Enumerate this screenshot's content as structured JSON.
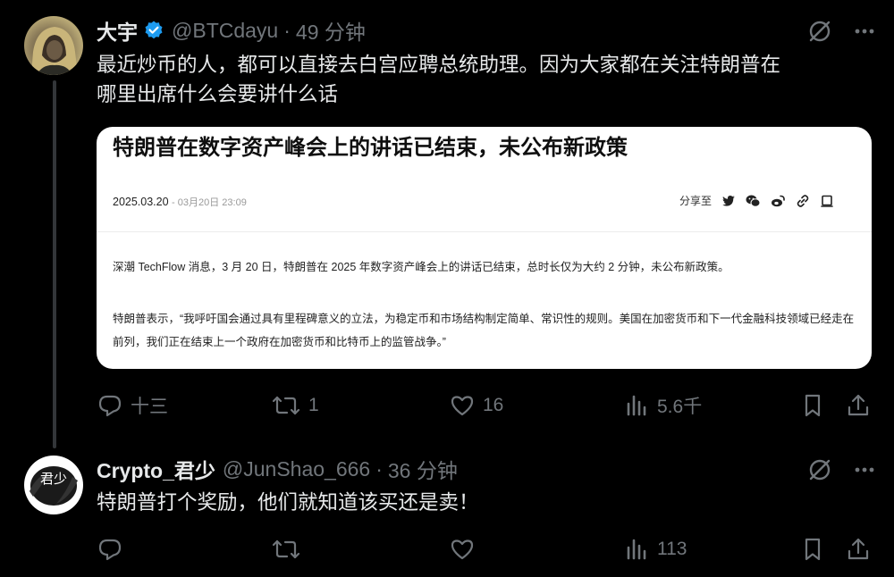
{
  "post": {
    "name": "大宇",
    "handle": "@BTCdayu",
    "separator": "·",
    "time": "49 分钟",
    "text_line1": "最近炒币的人，都可以直接去白宫应聘总统助理。因为大家都在关注特朗普在",
    "text_line2": "哪里出席什么会要讲什么话",
    "card": {
      "title": "特朗普在数字资产峰会上的讲话已结束，未公布新政策",
      "date": "2025.03.20",
      "date_sub": "- 03月20日 23:09",
      "share_label": "分享至",
      "para1": "深潮 TechFlow 消息，3 月 20 日，特朗普在 2025 年数字资产峰会上的讲话已结束，总时长仅为大约 2 分钟，未公布新政策。",
      "para2": "特朗普表示，“我呼吁国会通过具有里程碑意义的立法，为稳定币和市场结构制定简单、常识性的规则。美国在加密货币和下一代金融科技领域已经走在前列，我们正在结束上一个政府在加密货币和比特币上的监管战争。”"
    },
    "stats": {
      "replies": "十三",
      "reposts": "1",
      "likes": "16",
      "views": "5.6千"
    }
  },
  "reply": {
    "name": "Crypto_君少",
    "handle": "@JunShao_666",
    "separator": "·",
    "time": "36 分钟",
    "text": "特朗普打个奖励，他们就知道该买还是卖！",
    "avatar_text": "君少",
    "stats": {
      "views": "113"
    }
  },
  "colors": {
    "background": "#000000",
    "text": "#e7e9ea",
    "muted": "#71767b",
    "verified": "#1d9bf0",
    "thread_line": "#333639"
  }
}
